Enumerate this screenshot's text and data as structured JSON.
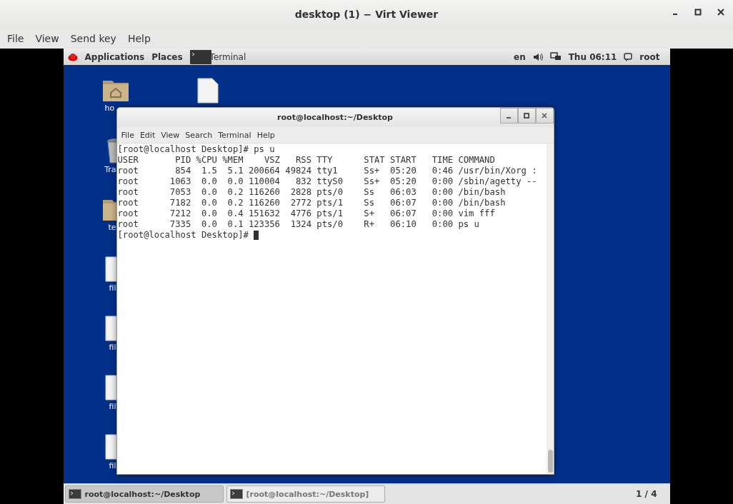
{
  "window": {
    "title": "desktop (1) − Virt Viewer"
  },
  "menu": [
    "File",
    "View",
    "Send key",
    "Help"
  ],
  "guest": {
    "top_bar": {
      "left": [
        "Applications",
        "Places"
      ],
      "task": "Terminal",
      "keyboard": "en",
      "clock": "Thu 06:11",
      "user": "root"
    },
    "desktop_icons": [
      {
        "kind": "home",
        "label": "ho"
      },
      {
        "kind": "file"
      },
      {
        "kind": "trash",
        "label": "Tra"
      },
      {
        "kind": "folder",
        "label": "te"
      },
      {
        "kind": "file",
        "label": "fil"
      },
      {
        "kind": "file",
        "label": "fil"
      },
      {
        "kind": "file",
        "label": "fil"
      },
      {
        "kind": "file",
        "label": "fil"
      }
    ],
    "terminal": {
      "title": "root@localhost:~/Desktop",
      "menu": [
        "File",
        "Edit",
        "View",
        "Search",
        "Terminal",
        "Help"
      ],
      "lines": [
        "[root@localhost Desktop]# ps u",
        "USER       PID %CPU %MEM    VSZ   RSS TTY      STAT START   TIME COMMAND",
        "root       854  1.5  5.1 200664 49824 tty1     Ss+  05:20   0:46 /usr/bin/Xorg :",
        "root      1063  0.0  0.0 110004   832 ttyS0    Ss+  05:20   0:00 /sbin/agetty --",
        "root      7053  0.0  0.2 116260  2828 pts/0    Ss   06:03   0:00 /bin/bash",
        "root      7182  0.0  0.2 116260  2772 pts/1    Ss   06:07   0:00 /bin/bash",
        "root      7212  0.0  0.4 151632  4776 pts/1    S+   06:07   0:00 vim fff",
        "root      7335  0.0  0.1 123356  1324 pts/0    R+   06:10   0:00 ps u"
      ],
      "prompt": "[root@localhost Desktop]# "
    },
    "taskbar": {
      "tasks": [
        {
          "label": "root@localhost:~/Desktop",
          "selected": true
        },
        {
          "label": "[root@localhost:~/Desktop]",
          "selected": false
        }
      ],
      "pager": "1 / 4"
    }
  }
}
